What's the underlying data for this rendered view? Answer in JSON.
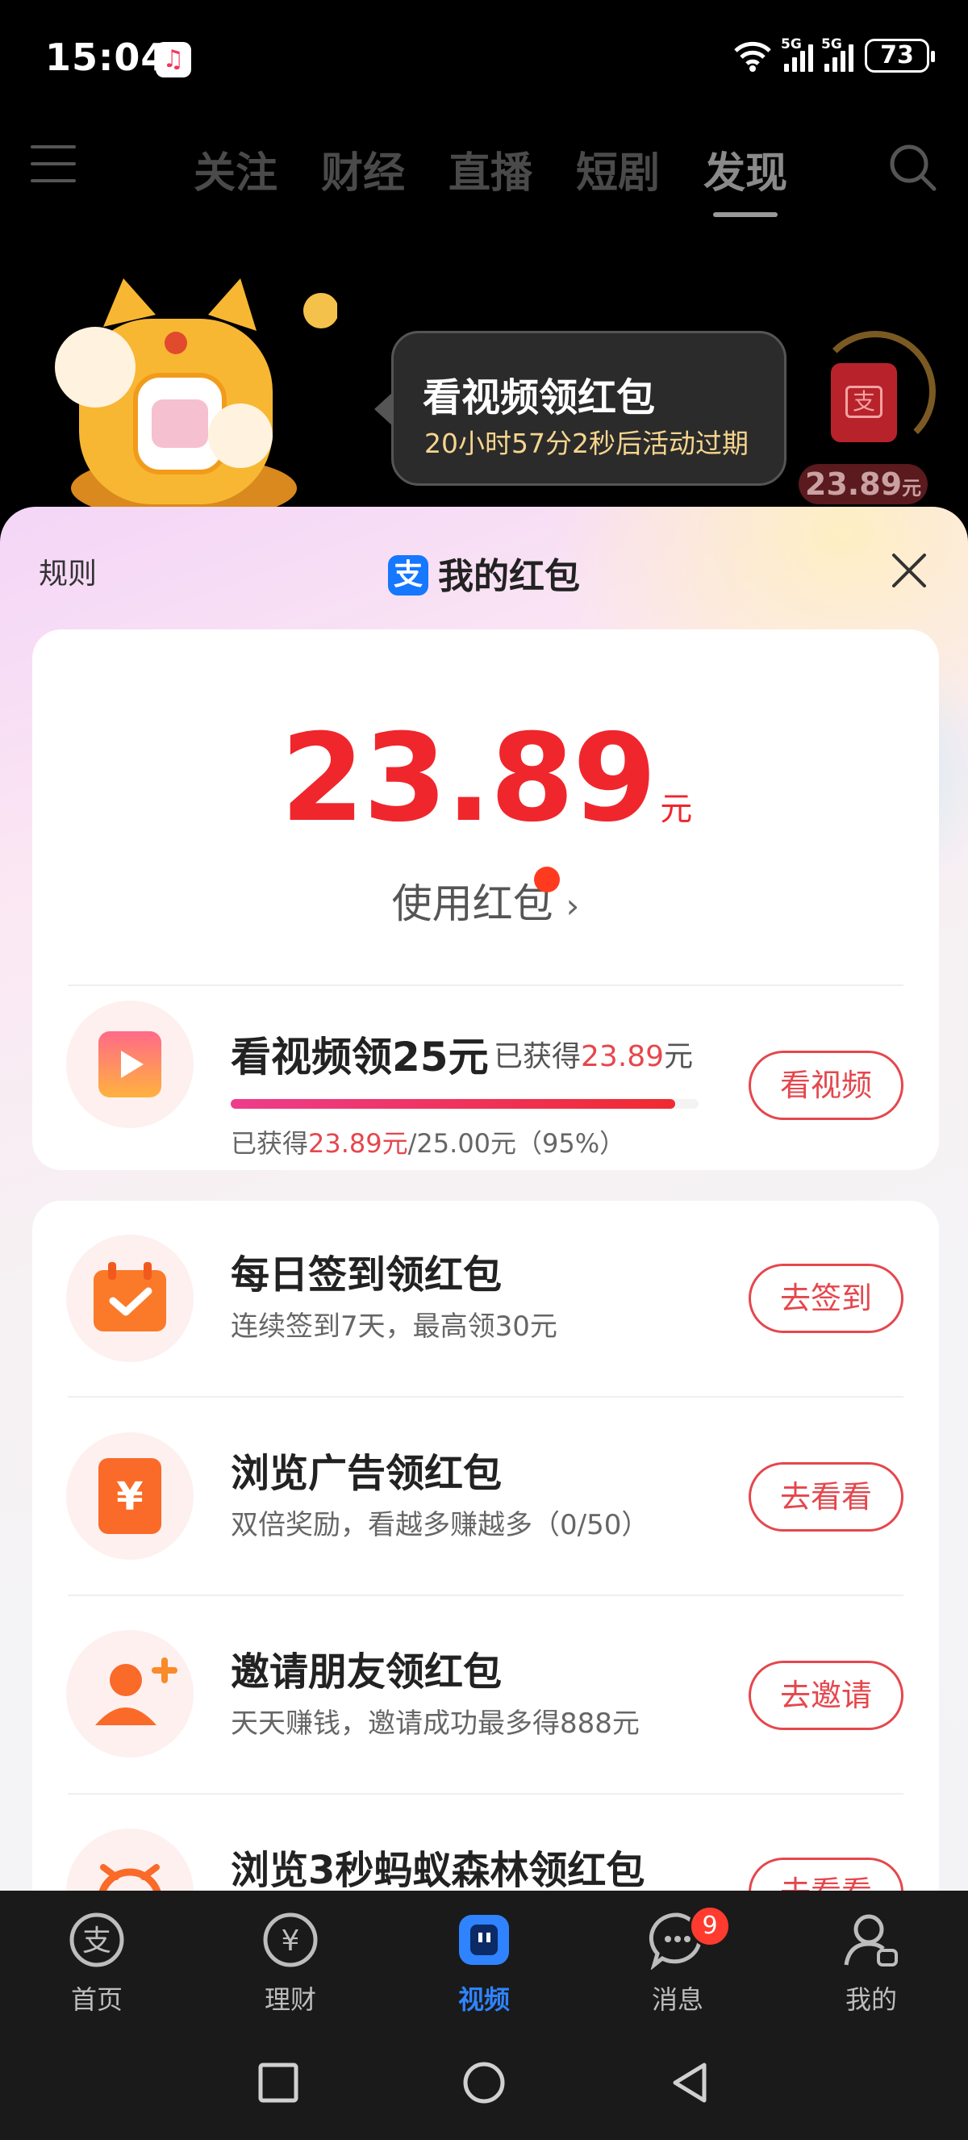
{
  "status_bar": {
    "time": "15:04",
    "network_1": "5G",
    "network_2": "5G",
    "battery": "73",
    "music_icon": "music-app-icon"
  },
  "top_nav": {
    "tabs": [
      "关注",
      "财经",
      "直播",
      "短剧",
      "发现"
    ],
    "active_tab": "发现"
  },
  "banner": {
    "bubble_title": "看视频领红包",
    "bubble_subtitle": "20小时57分2秒后活动过期",
    "float_amount": "23.89",
    "float_unit": "元"
  },
  "sheet": {
    "rules": "规则",
    "title": "我的红包",
    "logo_char": "支",
    "amount": "23.89",
    "amount_unit": "元",
    "use_link": "使用红包",
    "video_task": {
      "title": "看视频领25元",
      "got_prefix": "已获得",
      "got_value": "23.89",
      "got_unit": "元",
      "progress_percent": 95,
      "detail_prefix": "已获得",
      "detail_value": "23.89元",
      "detail_suffix": "/25.00元（95%）",
      "button": "看视频"
    },
    "tasks": [
      {
        "title": "每日签到领红包",
        "subtitle": "连续签到7天，最高领30元",
        "button": "去签到",
        "icon": "calendar-check-icon"
      },
      {
        "title": "浏览广告领红包",
        "subtitle": "双倍奖励，看越多赚越多（0/50）",
        "button": "去看看",
        "icon": "yuan-card-icon"
      },
      {
        "title": "邀请朋友领红包",
        "subtitle": "天天赚钱，邀请成功最多得888元",
        "button": "去邀请",
        "icon": "add-friend-icon"
      },
      {
        "title": "浏览3秒蚂蚁森林领红包",
        "subtitle": "",
        "button": "去看看",
        "icon": "alarm-clock-icon"
      }
    ]
  },
  "bottom_nav": {
    "items": [
      {
        "label": "首页",
        "icon": "alipay-home-icon"
      },
      {
        "label": "理财",
        "icon": "yuan-circle-icon"
      },
      {
        "label": "视频",
        "icon": "video-icon"
      },
      {
        "label": "消息",
        "icon": "chat-bubble-icon",
        "badge": "9"
      },
      {
        "label": "我的",
        "icon": "user-icon"
      }
    ],
    "active": "视频"
  },
  "colors": {
    "accent_red": "#e5474d",
    "amount_red": "#f0262d",
    "active_blue": "#2f83ff"
  }
}
